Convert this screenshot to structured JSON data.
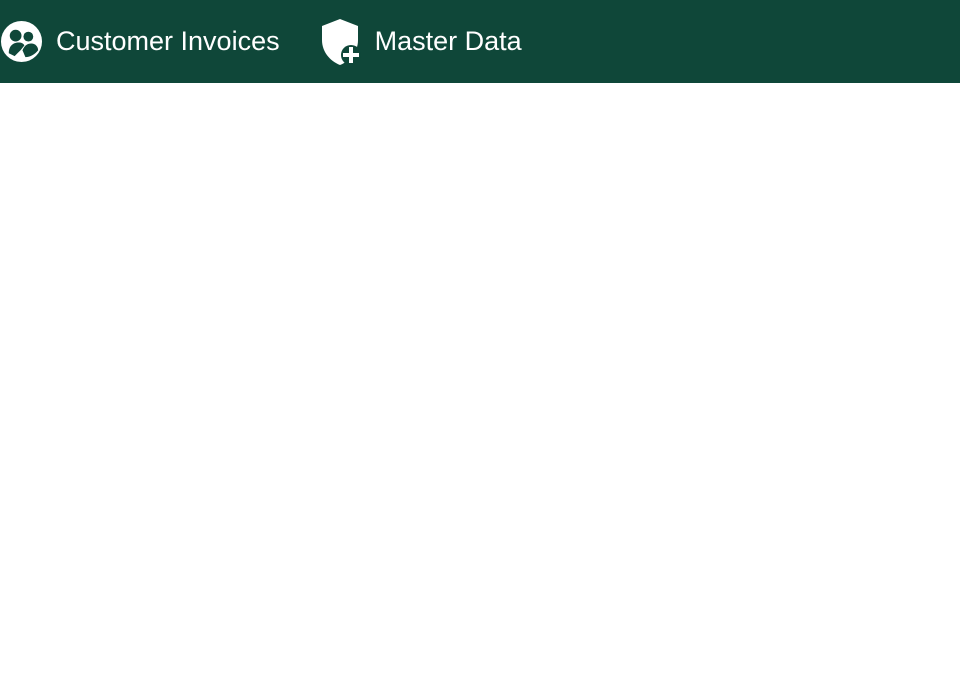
{
  "nav": {
    "items": [
      {
        "label": "Customer Invoices",
        "icon": "group-icon"
      },
      {
        "label": "Master Data",
        "icon": "shield-plus-icon"
      }
    ]
  },
  "colors": {
    "header_bg": "#0f4739",
    "header_text": "#ffffff",
    "content_bg": "#ffffff"
  }
}
